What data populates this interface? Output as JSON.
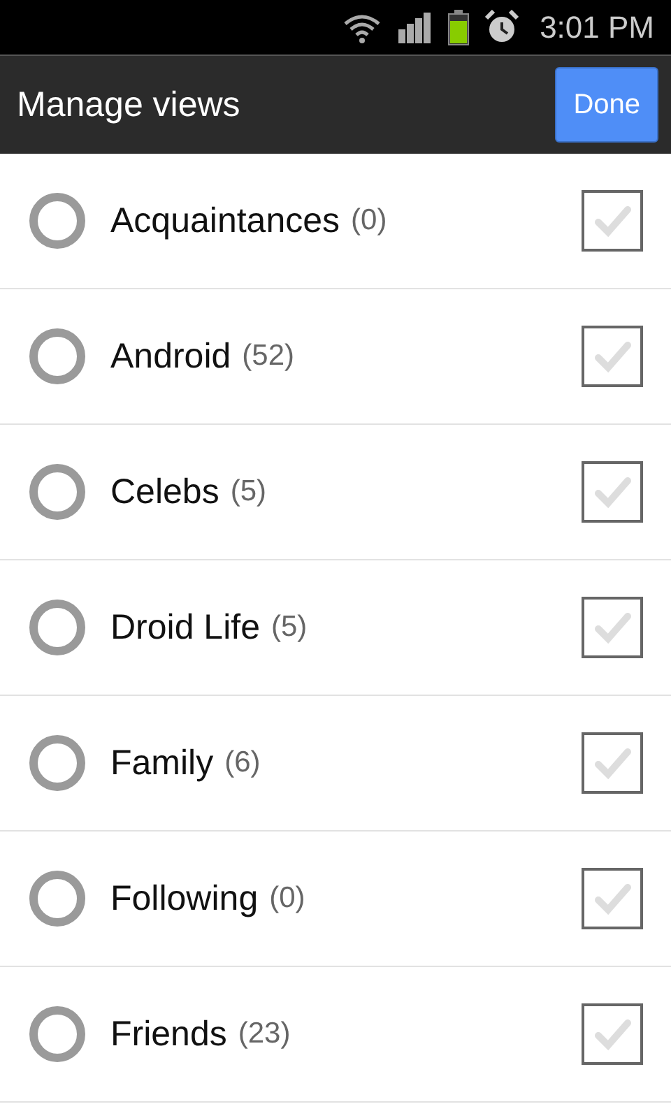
{
  "status_bar": {
    "time": "3:01 PM"
  },
  "header": {
    "title": "Manage views",
    "done_button": "Done"
  },
  "views": [
    {
      "name": "Acquaintances",
      "count": "(0)",
      "selected": false,
      "checked": false
    },
    {
      "name": "Android",
      "count": "(52)",
      "selected": false,
      "checked": false
    },
    {
      "name": "Celebs",
      "count": "(5)",
      "selected": false,
      "checked": false
    },
    {
      "name": "Droid Life",
      "count": "(5)",
      "selected": false,
      "checked": false
    },
    {
      "name": "Family",
      "count": "(6)",
      "selected": false,
      "checked": false
    },
    {
      "name": "Following",
      "count": "(0)",
      "selected": false,
      "checked": false
    },
    {
      "name": "Friends",
      "count": "(23)",
      "selected": false,
      "checked": false
    }
  ]
}
